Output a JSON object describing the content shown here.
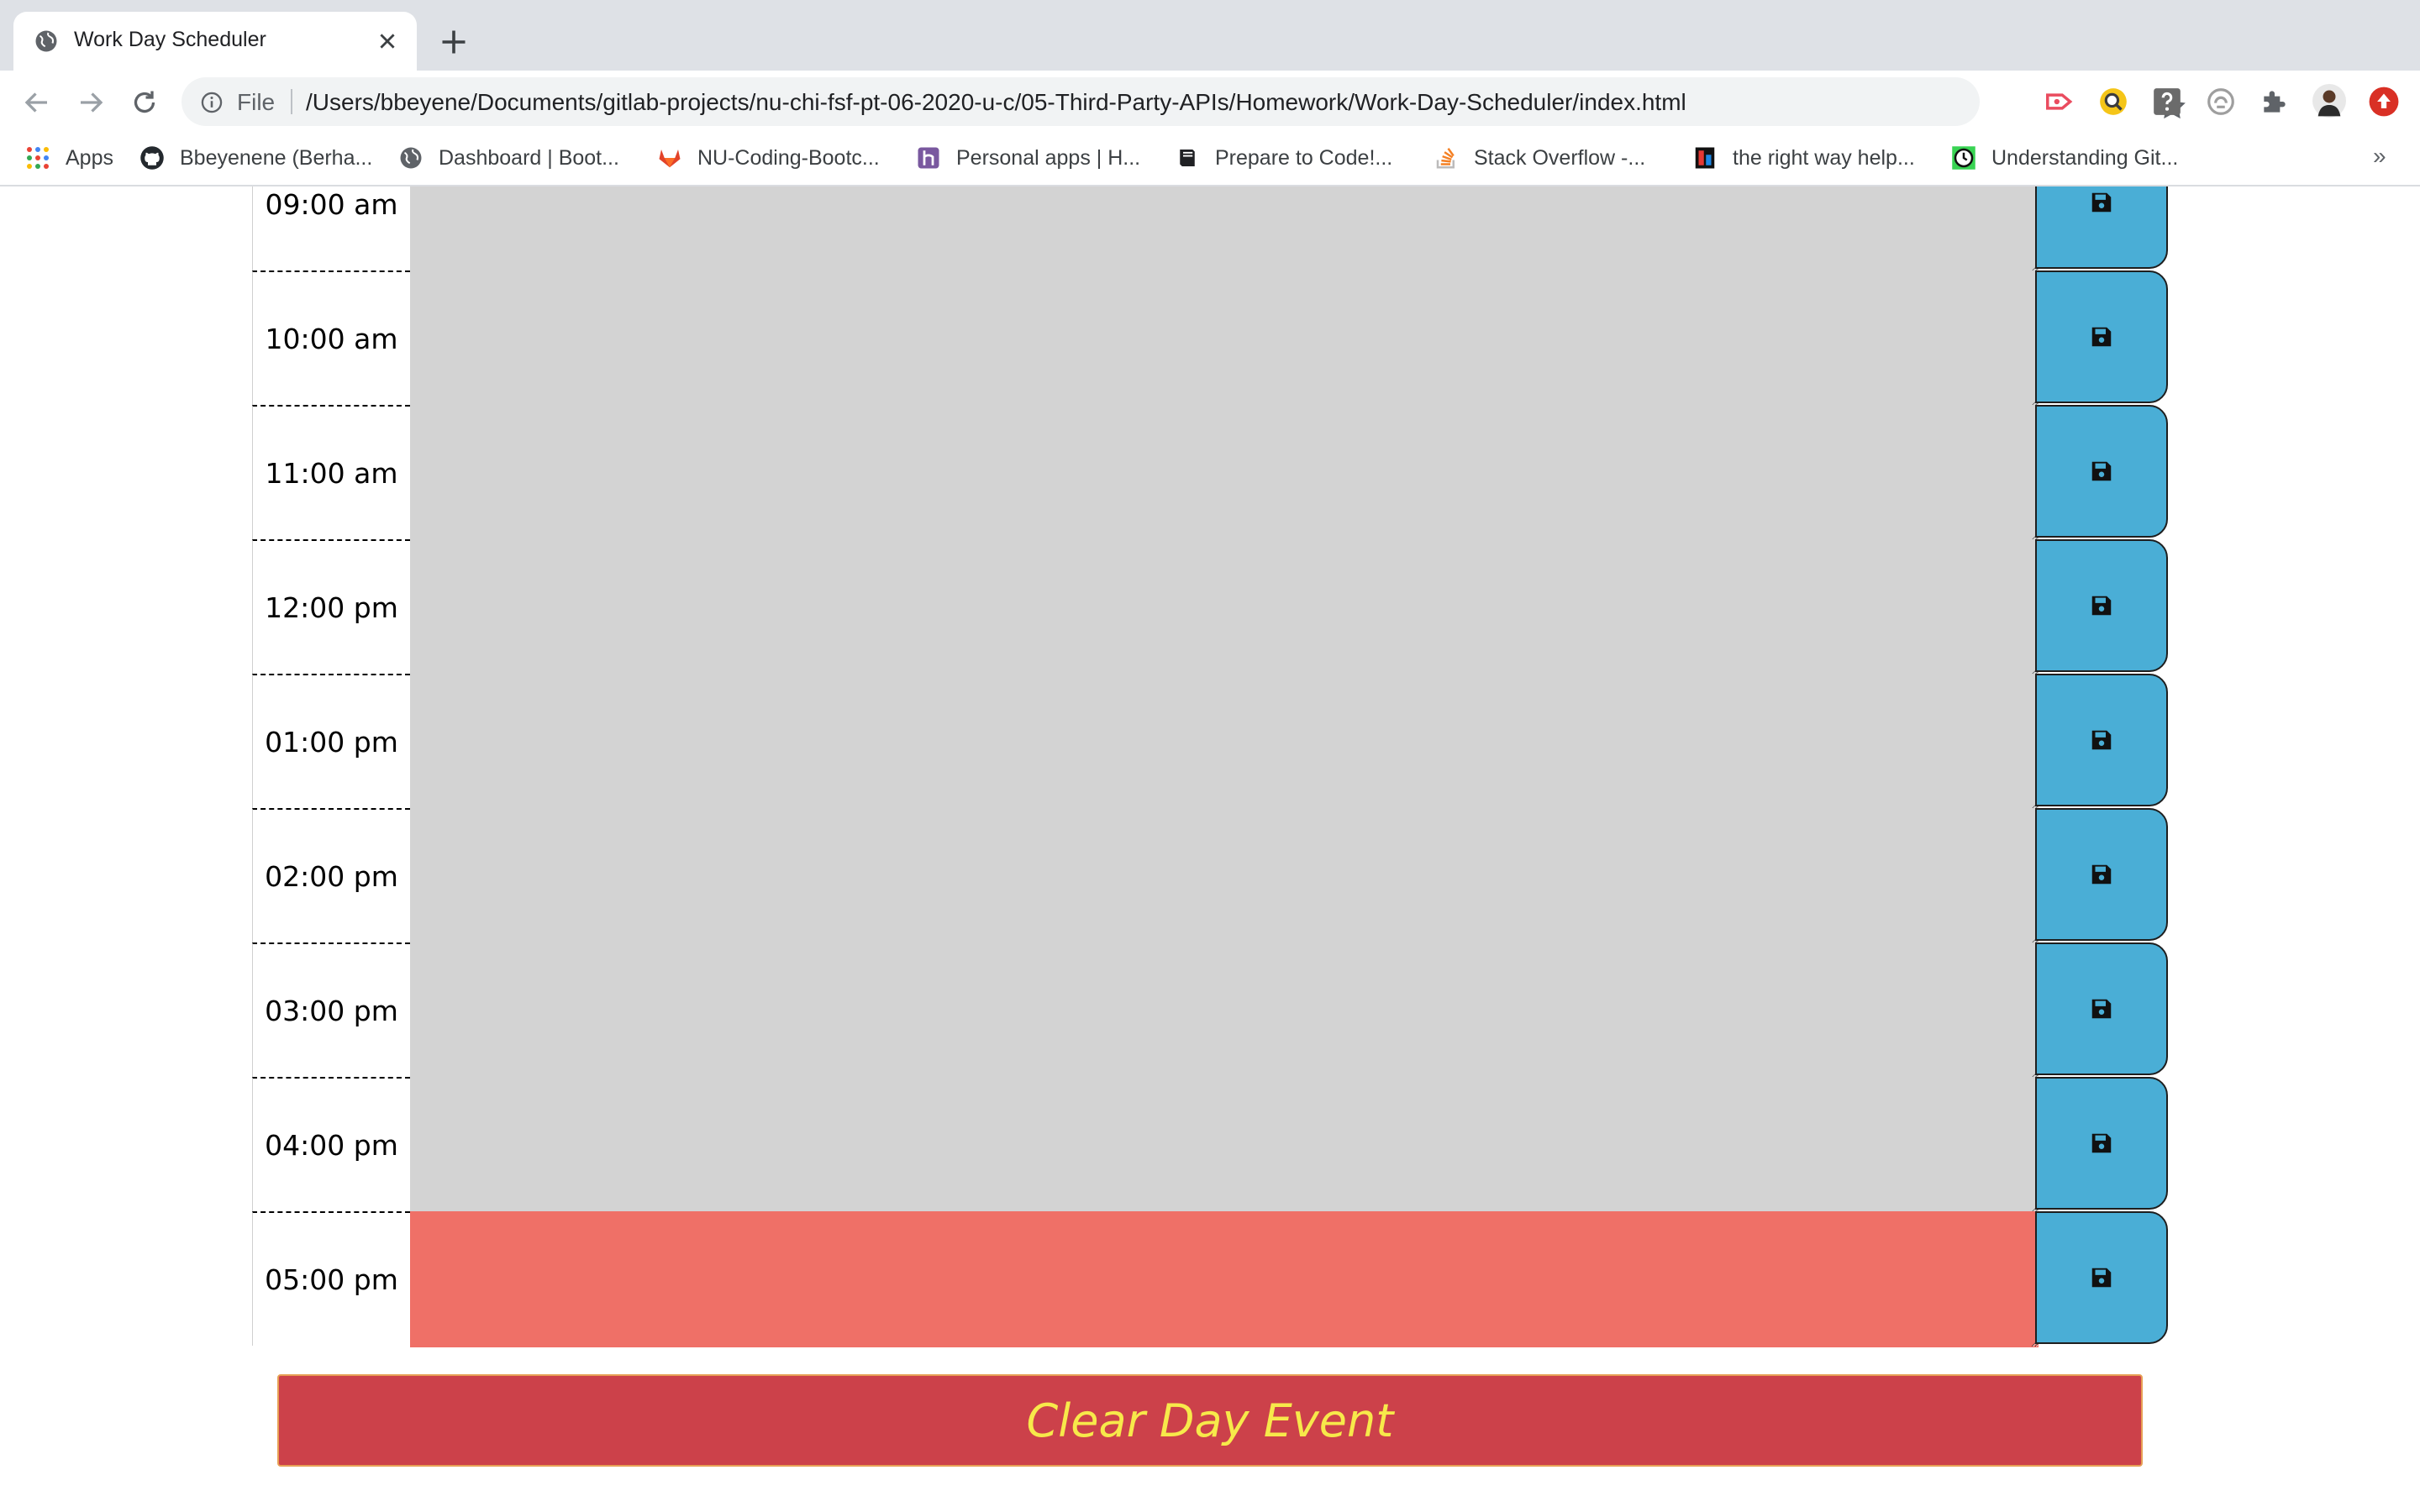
{
  "browser": {
    "tab_title": "Work Day Scheduler",
    "scheme_label": "File",
    "url": "/Users/bbeyene/Documents/gitlab-projects/nu-chi-fsf-pt-06-2020-u-c/05-Third-Party-APIs/Homework/Work-Day-Scheduler/index.html",
    "extensions": [
      "video-extension-icon",
      "search-extension-icon",
      "help-extension-icon",
      "sync-extension-icon",
      "extensions-puzzle-icon",
      "profile-avatar",
      "update-icon"
    ]
  },
  "bookmarks": [
    {
      "label": "Apps",
      "icon": "apps-grid-icon"
    },
    {
      "label": "Bbeyenene (Berha...",
      "icon": "github-icon"
    },
    {
      "label": "Dashboard | Boot...",
      "icon": "globe-icon"
    },
    {
      "label": "NU-Coding-Bootc...",
      "icon": "gitlab-icon"
    },
    {
      "label": "Personal apps | H...",
      "icon": "heroku-icon"
    },
    {
      "label": "Prepare to Code!...",
      "icon": "book-icon"
    },
    {
      "label": "Stack Overflow -...",
      "icon": "stackoverflow-icon"
    },
    {
      "label": "the right way help...",
      "icon": "bookmark-icon"
    },
    {
      "label": "Understanding Git...",
      "icon": "clock-icon"
    }
  ],
  "scheduler": {
    "rows": [
      {
        "hour": "09:00 am",
        "state": "past"
      },
      {
        "hour": "10:00 am",
        "state": "past"
      },
      {
        "hour": "11:00 am",
        "state": "past"
      },
      {
        "hour": "12:00 pm",
        "state": "past"
      },
      {
        "hour": "01:00 pm",
        "state": "past"
      },
      {
        "hour": "02:00 pm",
        "state": "past"
      },
      {
        "hour": "03:00 pm",
        "state": "past"
      },
      {
        "hour": "04:00 pm",
        "state": "past"
      },
      {
        "hour": "05:00 pm",
        "state": "present"
      }
    ],
    "colors": {
      "past": "#d3d3d3",
      "present": "#ef7067",
      "save": "#4aaed6"
    },
    "clear_label": "Clear Day Event"
  }
}
